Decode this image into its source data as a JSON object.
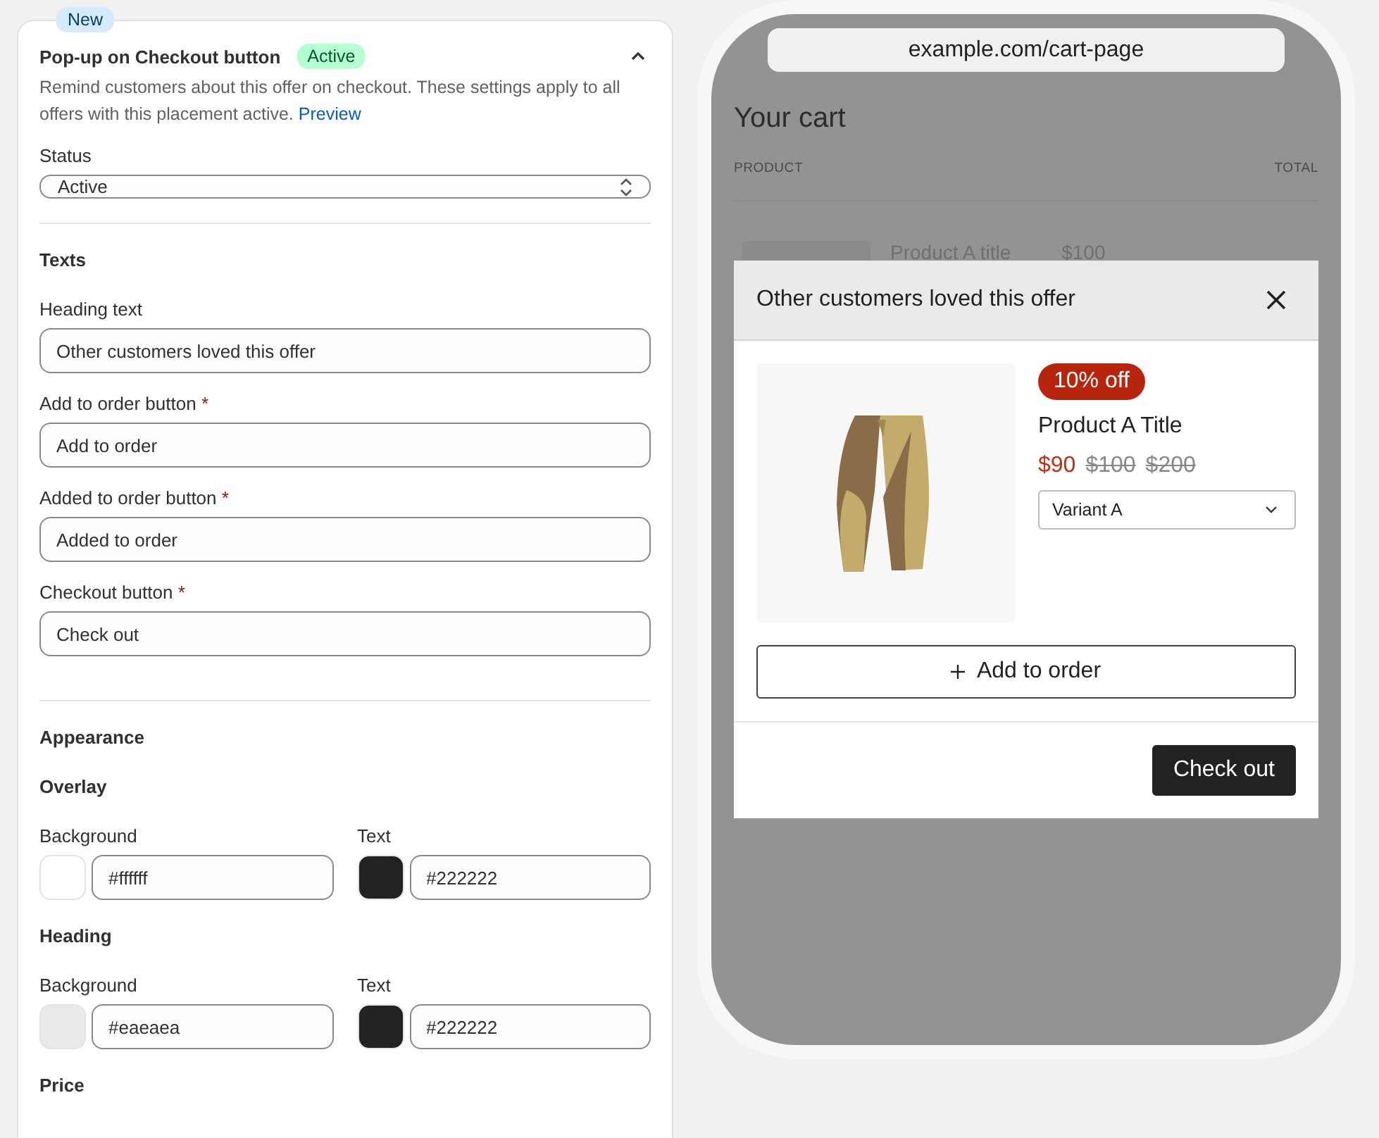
{
  "badge": "New",
  "section": {
    "title": "Pop-up on Checkout button",
    "status_badge": "Active",
    "expanded": true,
    "description": "Remind customers about this offer on checkout. These settings apply to all offers with this placement active.",
    "link": "Preview"
  },
  "status_field": {
    "label": "Status",
    "value": "Active"
  },
  "texts": {
    "heading": "Texts",
    "fields": [
      {
        "label": "Heading text",
        "value": "Other customers loved this offer"
      },
      {
        "label": "Add to order button",
        "required_mark": "*",
        "value": "Add to order"
      },
      {
        "label": "Added to order button",
        "required_mark": "*",
        "value": "Added to order"
      },
      {
        "label": "Checkout button",
        "required_mark": "*",
        "value": "Check out"
      }
    ]
  },
  "appearance": {
    "heading": "Appearance",
    "groups": [
      {
        "heading": "Overlay",
        "colors": [
          {
            "label": "Background",
            "color": "#ffffff",
            "value": "#ffffff"
          },
          {
            "label": "Text",
            "color": "#222222",
            "value": "#222222"
          }
        ]
      },
      {
        "heading": "Heading",
        "colors": [
          {
            "label": "Background",
            "color": "#eaeaea",
            "value": "#eaeaea"
          },
          {
            "label": "Text",
            "color": "#222222",
            "value": "#222222"
          }
        ]
      },
      {
        "heading": "Price"
      }
    ]
  },
  "preview": {
    "url": "example.com/cart-page",
    "page_title": "Your cart",
    "columns": [
      "PRODUCT",
      "TOTAL"
    ],
    "cart_item": {
      "title": "Product A title",
      "price": "$100"
    },
    "popup": {
      "title": "Other customers loved this offer",
      "discount": "10% off",
      "product_title": "Product A Title",
      "prices": [
        {
          "text": "$90",
          "kind": "sale"
        },
        {
          "text": "$100",
          "kind": "compare"
        },
        {
          "text": "$200",
          "kind": "compare"
        }
      ],
      "variant": "Variant A",
      "add_button": "Add to order",
      "checkout_button": "Check out"
    }
  }
}
